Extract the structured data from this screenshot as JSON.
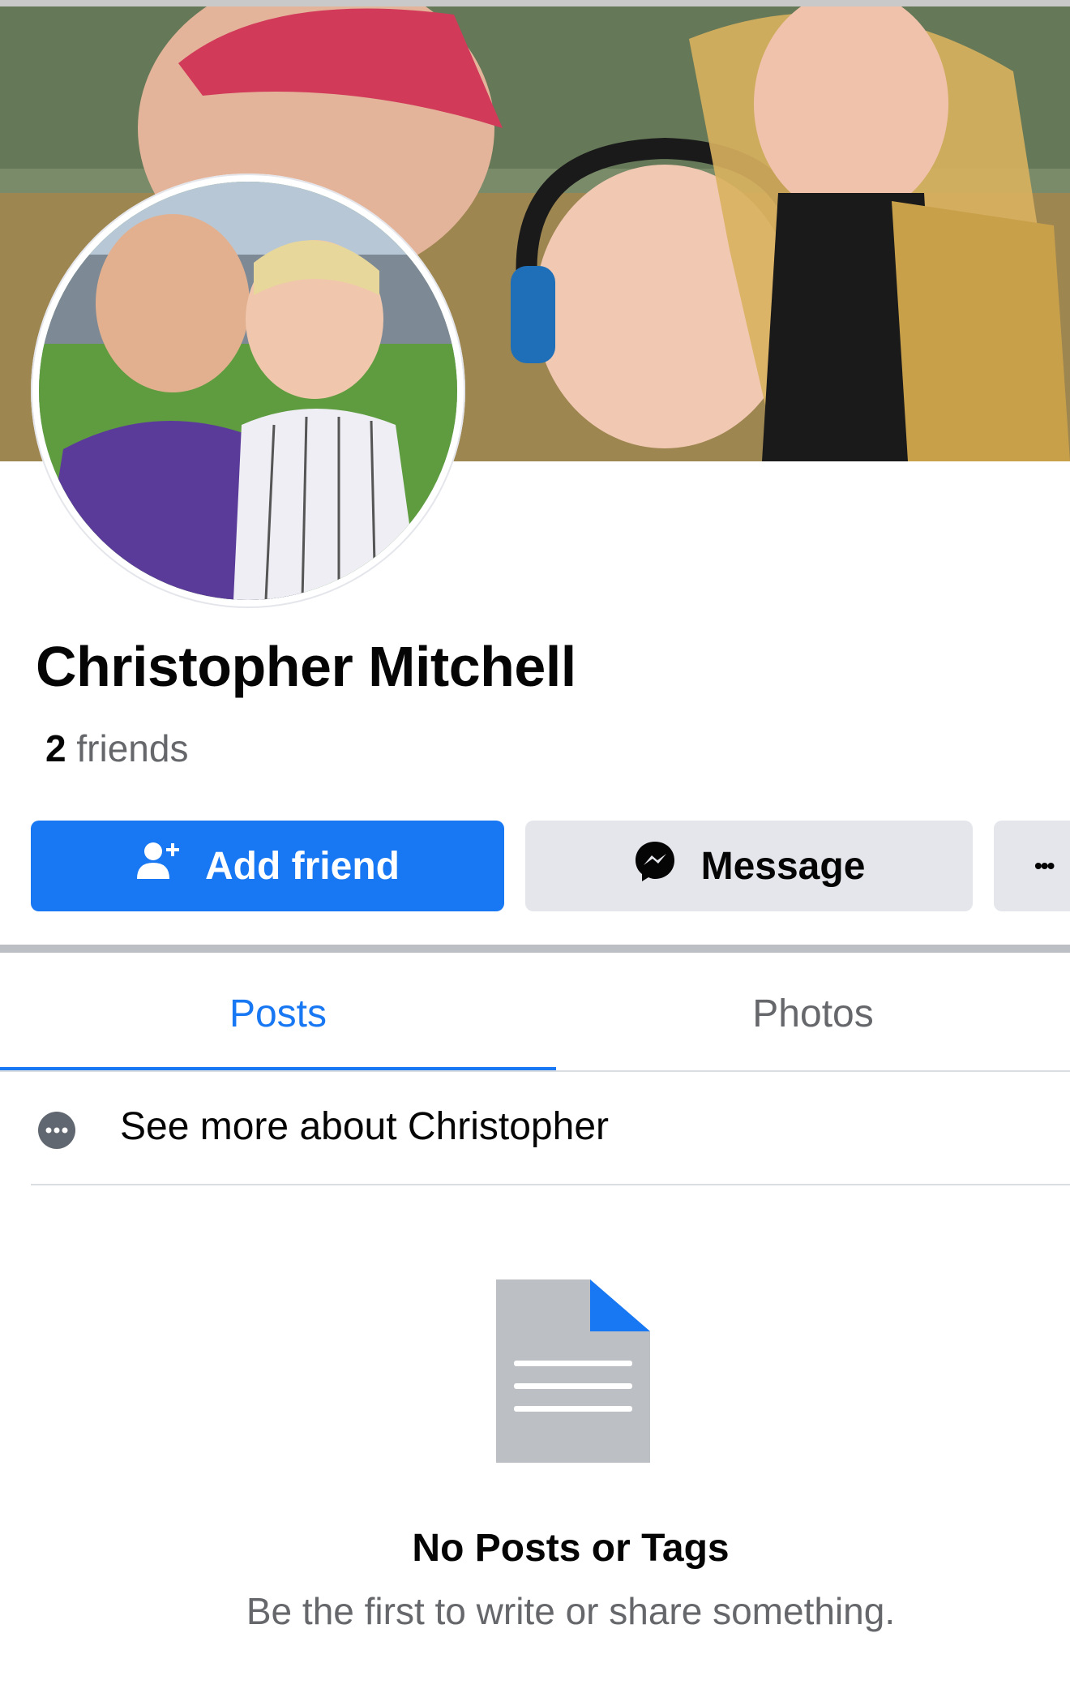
{
  "profile": {
    "name": "Christopher Mitchell",
    "friends_count": "2",
    "friends_label": "friends"
  },
  "actions": {
    "add_friend_label": "Add friend",
    "message_label": "Message",
    "more_label": "•••"
  },
  "tabs": [
    {
      "label": "Posts",
      "active": true
    },
    {
      "label": "Photos",
      "active": false
    }
  ],
  "about": {
    "see_more_label": "See more about Christopher"
  },
  "empty_state": {
    "title": "No Posts or Tags",
    "subtitle": "Be the first to write or share something."
  },
  "colors": {
    "accent": "#1877f2",
    "button_gray": "#e4e6eb",
    "text_primary": "#050505",
    "text_secondary": "#65676b"
  },
  "icons": {
    "add_friend": "add-person-icon",
    "message": "messenger-icon",
    "more": "more-dots-icon",
    "about": "info-dots-icon",
    "empty": "document-icon"
  }
}
